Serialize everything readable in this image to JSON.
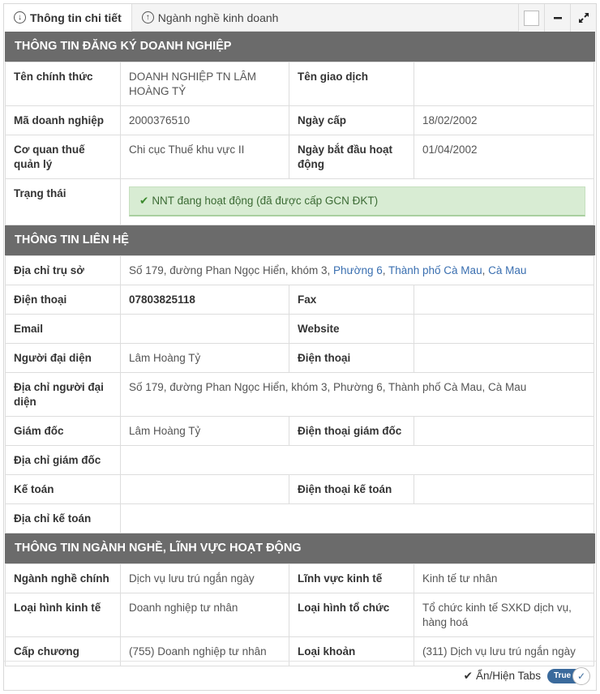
{
  "tabs": [
    {
      "label": "Thông tin chi tiết",
      "icon": "arrow-down-circle-icon"
    },
    {
      "label": "Ngành nghề kinh doanh",
      "icon": "arrow-up-circle-icon"
    }
  ],
  "sections": {
    "registration": {
      "title": "THÔNG TIN ĐĂNG KÝ DOANH NGHIỆP",
      "official_name_label": "Tên chính thức",
      "official_name": "DOANH NGHIỆP TN LÂM HOÀNG TỶ",
      "trade_name_label": "Tên giao dịch",
      "trade_name": "",
      "company_code_label": "Mã doanh nghiệp",
      "company_code": "2000376510",
      "issue_date_label": "Ngày cấp",
      "issue_date": "18/02/2002",
      "tax_office_label": "Cơ quan thuế quản lý",
      "tax_office": "Chi cục Thuế khu vực II",
      "start_date_label": "Ngày bắt đầu hoạt động",
      "start_date": "01/04/2002",
      "status_label": "Trạng thái",
      "status": "NNT đang hoạt động (đã được cấp GCN ĐKT)"
    },
    "contact": {
      "title": "THÔNG TIN LIÊN HỆ",
      "hq_address_label": "Địa chỉ trụ sở",
      "hq_address_plain": "Số 179, đường Phan Ngọc Hiển, khóm 3, ",
      "hq_address_ward": "Phường 6",
      "hq_address_sep1": ", ",
      "hq_address_city": "Thành phố Cà Mau",
      "hq_address_sep2": ", ",
      "hq_address_province": "Cà Mau",
      "phone_label": "Điện thoại",
      "phone": "07803825118",
      "fax_label": "Fax",
      "fax": "",
      "email_label": "Email",
      "email": "",
      "website_label": "Website",
      "website": "",
      "representative_label": "Người đại diện",
      "representative": "Lâm Hoàng Tỷ",
      "rep_phone_label": "Điện thoại",
      "rep_phone": "",
      "rep_address_label": "Địa chỉ người đại diện",
      "rep_address": "Số 179, đường Phan Ngọc Hiển, khóm 3, Phường 6, Thành phố Cà Mau, Cà Mau",
      "director_label": "Giám đốc",
      "director": "Lâm Hoàng Tỷ",
      "director_phone_label": "Điện thoại giám đốc",
      "director_phone": "",
      "director_address_label": "Địa chỉ giám đốc",
      "director_address": "",
      "accountant_label": "Kế toán",
      "accountant": "",
      "accountant_phone_label": "Điện thoại kế toán",
      "accountant_phone": "",
      "accountant_address_label": "Địa chỉ kế toán",
      "accountant_address": ""
    },
    "industry": {
      "title": "THÔNG TIN NGÀNH NGHỀ, LĨNH VỰC HOẠT ĐỘNG",
      "main_industry_label": "Ngành nghề chính",
      "main_industry": "Dịch vụ lưu trú ngắn ngày",
      "economic_field_label": "Lĩnh vực kinh tế",
      "economic_field": "Kinh tế tư nhân",
      "economic_type_label": "Loại hình kinh tế",
      "economic_type": "Doanh nghiệp tư nhân",
      "org_type_label": "Loại hình tổ chức",
      "org_type": "Tổ chức kinh tế SXKD dịch vụ, hàng hoá",
      "chapter_label": "Cấp chương",
      "chapter": "(755) Doanh nghiệp tư nhân",
      "item_label": "Loại khoản",
      "item": "(311) Dịch vụ lưu trú ngắn ngày"
    }
  },
  "footer": {
    "toggle_label": "Ẩn/Hiện Tabs",
    "toggle_value": "True"
  },
  "colors": {
    "section_header_bg": "#6b6b6b",
    "status_bg": "#d8ecd3",
    "link": "#3a6fb0",
    "toggle": "#3a6a9c"
  }
}
